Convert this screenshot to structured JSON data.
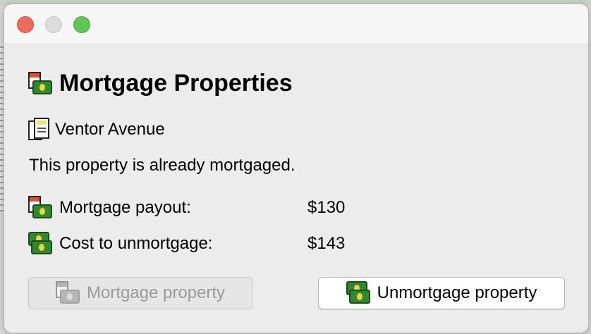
{
  "window": {
    "controls": {
      "close": "close-button",
      "minimize": "minimize-button",
      "zoom": "zoom-button"
    }
  },
  "dialog": {
    "title": "Mortgage Properties",
    "property_name": "Ventor Avenue",
    "status_message": "This property is already mortgaged.",
    "mortgage_payout_label": "Mortgage payout:",
    "mortgage_payout_value": "$130",
    "unmortgage_cost_label": "Cost to unmortgage:",
    "unmortgage_cost_value": "$143",
    "buttons": {
      "mortgage": {
        "label": "Mortgage property",
        "enabled": false
      },
      "unmortgage": {
        "label": "Unmortgage property",
        "enabled": true
      }
    }
  },
  "icons": {
    "title": "mortgage-icon",
    "property": "property-deed-icon",
    "payout": "mortgage-icon",
    "cost": "money-icon"
  },
  "colors": {
    "close": "#ed6a5e",
    "minimize": "#dcdcdc",
    "zoom": "#61c454",
    "disabled_text": "#9a9a9a"
  }
}
